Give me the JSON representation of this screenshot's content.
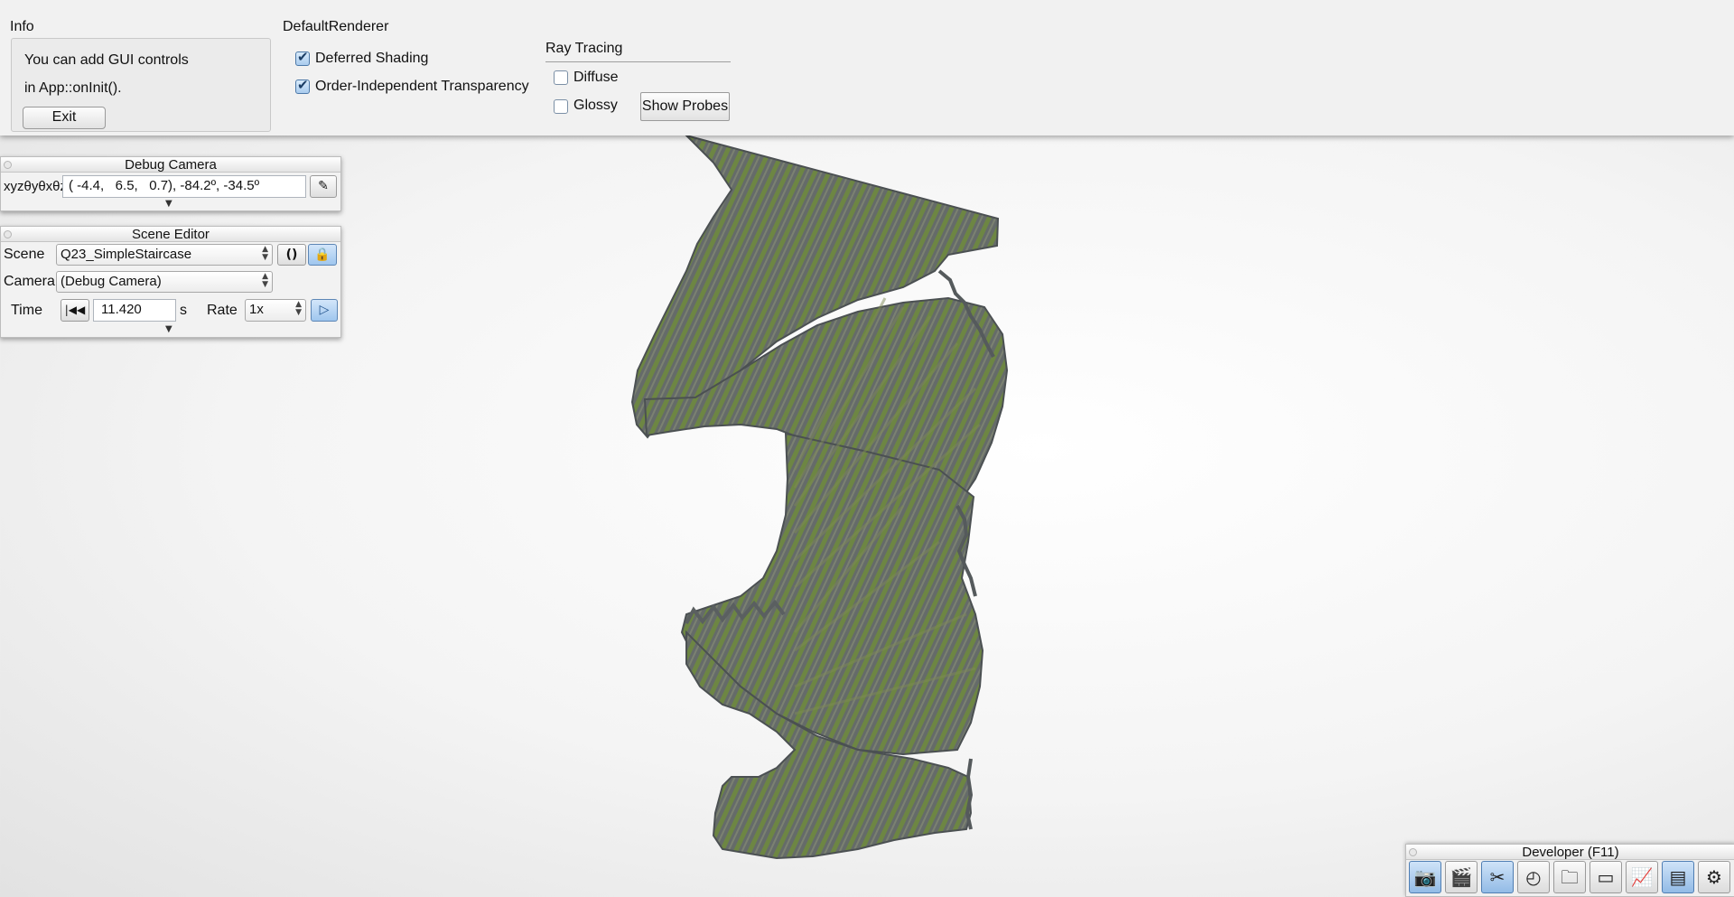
{
  "info": {
    "title": "Info",
    "line1": "You can add GUI controls",
    "line2": "in App::onInit().",
    "exit_label": "Exit"
  },
  "renderer": {
    "title": "DefaultRenderer",
    "deferred_shading": {
      "label": "Deferred Shading",
      "checked": true
    },
    "oit": {
      "label": "Order-Independent Transparency",
      "checked": true
    },
    "ray_tracing": {
      "title": "Ray Tracing",
      "diffuse": {
        "label": "Diffuse",
        "checked": false
      },
      "glossy": {
        "label": "Glossy",
        "checked": false
      },
      "show_probes_label": "Show Probes"
    }
  },
  "debug_camera": {
    "title": "Debug Camera",
    "coord_label": "xyzθyθxθz",
    "value": "( -4.4,   6.5,   0.7), -84.2º, -34.5º"
  },
  "scene_editor": {
    "title": "Scene Editor",
    "scene_label": "Scene",
    "scene_value": "Q23_SimpleStaircase",
    "camera_label": "Camera",
    "camera_value": "(Debug Camera)",
    "time_label": "Time",
    "time_value": "11.420",
    "time_unit": "s",
    "rate_label": "Rate",
    "rate_value": "1x"
  },
  "developer": {
    "title": "Developer (F11)",
    "buttons": [
      {
        "icon": "camera-icon",
        "active": true
      },
      {
        "icon": "clapperboard-icon",
        "active": false
      },
      {
        "icon": "tools-icon",
        "active": true
      },
      {
        "icon": "profiler-clock-icon",
        "active": false
      },
      {
        "icon": "folder-icon",
        "active": false
      },
      {
        "icon": "scene-window-icon",
        "active": false
      },
      {
        "icon": "graph-monitor-icon",
        "active": false
      },
      {
        "icon": "console-document-icon",
        "active": true
      },
      {
        "icon": "gear-icon",
        "active": false
      }
    ]
  },
  "colors": {
    "stair_stone": "#6a6f70",
    "stair_moss": "#6e8a3e",
    "panel_bg": "#f1f1f1",
    "active_blue": "#a9cbee"
  }
}
